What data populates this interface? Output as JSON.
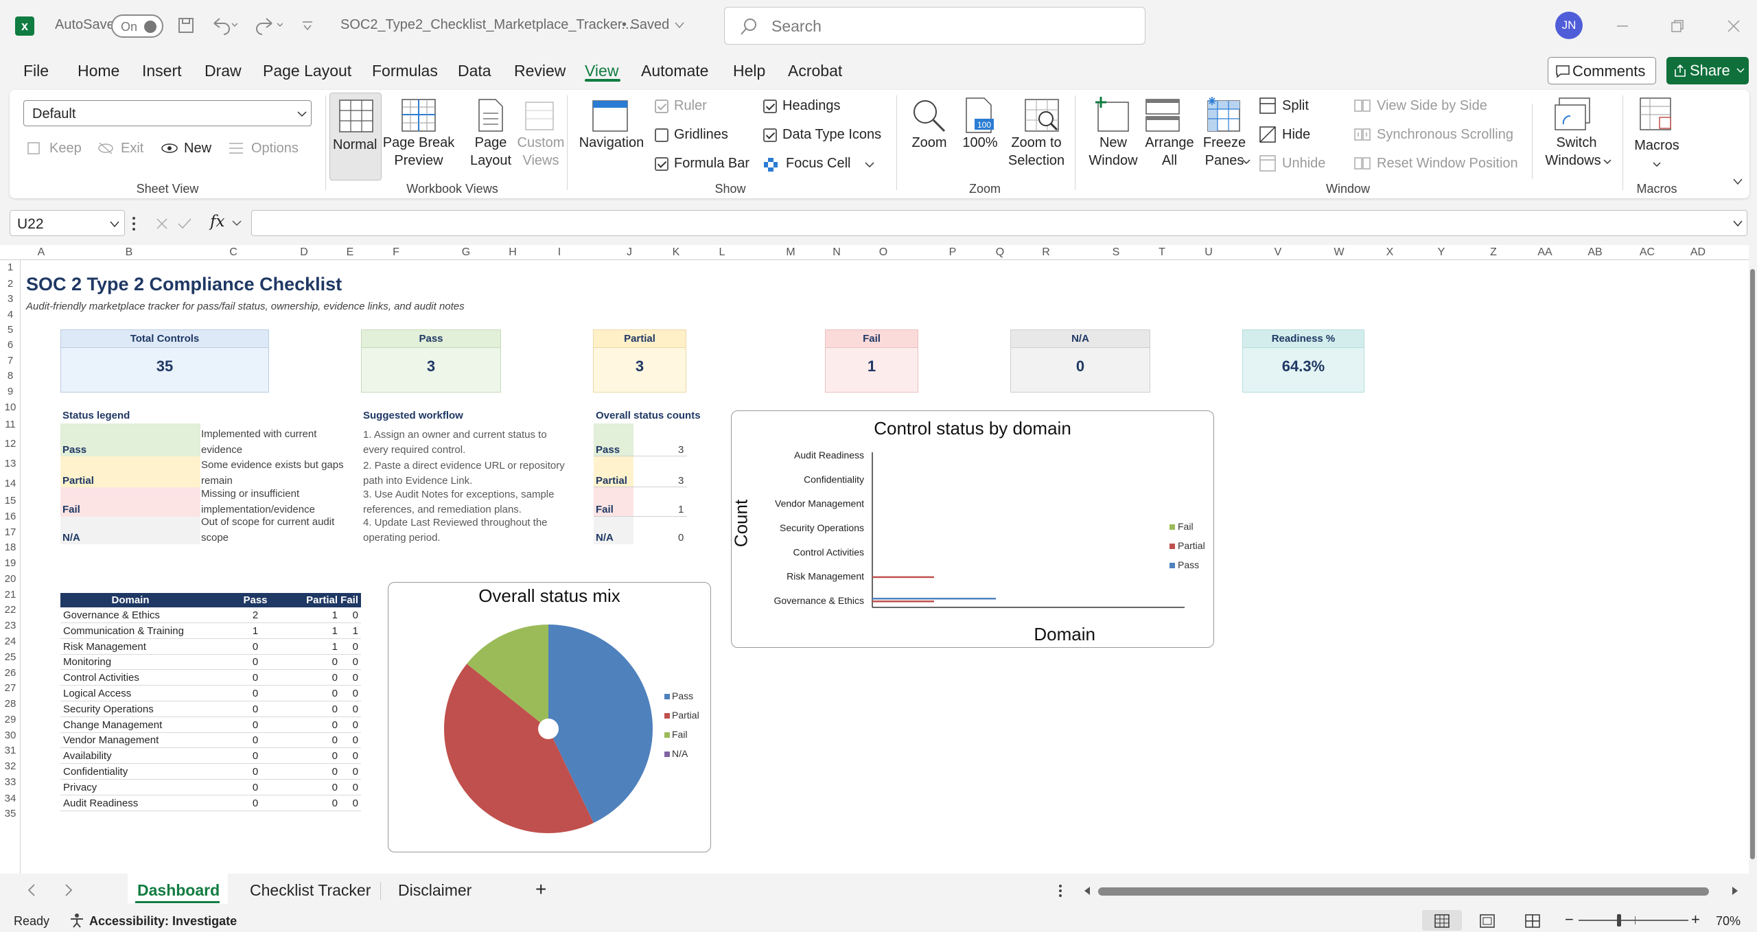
{
  "titlebar": {
    "autosave_label": "AutoSave",
    "autosave_state": "On",
    "filename": "SOC2_Type2_Checklist_Marketplace_Tracker....",
    "save_status": "• Saved",
    "search_placeholder": "Search",
    "avatar_initials": "JN"
  },
  "menu": {
    "items": [
      "File",
      "Home",
      "Insert",
      "Draw",
      "Page Layout",
      "Formulas",
      "Data",
      "Review",
      "View",
      "Automate",
      "Help",
      "Acrobat"
    ],
    "active": "View",
    "comments": "Comments",
    "share": "Share"
  },
  "ribbon": {
    "sheet_view": {
      "select_value": "Default",
      "keep": "Keep",
      "exit": "Exit",
      "new": "New",
      "options": "Options",
      "group": "Sheet View"
    },
    "workbook_views": {
      "normal": "Normal",
      "page_break_1": "Page Break",
      "page_break_2": "Preview",
      "page_layout_1": "Page",
      "page_layout_2": "Layout",
      "custom_1": "Custom",
      "custom_2": "Views",
      "group": "Workbook Views"
    },
    "show": {
      "navigation": "Navigation",
      "ruler": "Ruler",
      "gridlines": "Gridlines",
      "formula_bar": "Formula Bar",
      "headings": "Headings",
      "data_type_icons": "Data Type Icons",
      "focus_cell": "Focus Cell",
      "group": "Show"
    },
    "zoom": {
      "zoom": "Zoom",
      "hundred": "100%",
      "zoom_sel_1": "Zoom to",
      "zoom_sel_2": "Selection",
      "group": "Zoom"
    },
    "window": {
      "new_1": "New",
      "new_2": "Window",
      "arrange_1": "Arrange",
      "arrange_2": "All",
      "freeze_1": "Freeze",
      "freeze_2": "Panes",
      "split": "Split",
      "hide": "Hide",
      "unhide": "Unhide",
      "side_by_side": "View Side by Side",
      "sync": "Synchronous Scrolling",
      "reset": "Reset Window Position",
      "switch_1": "Switch",
      "switch_2": "Windows",
      "group": "Window"
    },
    "macros": {
      "macros": "Macros",
      "group": "Macros"
    }
  },
  "formula_bar": {
    "name_box": "U22",
    "fx": "fx",
    "formula": ""
  },
  "columns": [
    "A",
    "B",
    "C",
    "D",
    "E",
    "F",
    "G",
    "H",
    "I",
    "J",
    "K",
    "L",
    "M",
    "N",
    "O",
    "P",
    "Q",
    "R",
    "S",
    "T",
    "U",
    "V",
    "W",
    "X",
    "Y",
    "Z",
    "AA",
    "AB",
    "AC",
    "AD"
  ],
  "rows": [
    "1",
    "2",
    "3",
    "4",
    "5",
    "6",
    "7",
    "8",
    "9",
    "10",
    "11",
    "12",
    "13",
    "14",
    "15",
    "16",
    "17",
    "18",
    "19",
    "20",
    "21",
    "22",
    "23",
    "24",
    "25",
    "26",
    "27",
    "28",
    "29",
    "30",
    "31",
    "32",
    "33",
    "34",
    "35"
  ],
  "sheet": {
    "title": "SOC 2 Type 2 Compliance Checklist",
    "subtitle": "Audit-friendly marketplace tracker for pass/fail status, ownership, evidence links, and audit notes",
    "kpis": [
      {
        "label": "Total Controls",
        "value": "35"
      },
      {
        "label": "Pass",
        "value": "3"
      },
      {
        "label": "Partial",
        "value": "3"
      },
      {
        "label": "Fail",
        "value": "1"
      },
      {
        "label": "N/A",
        "value": "0"
      },
      {
        "label": "Readiness %",
        "value": "64.3%"
      }
    ],
    "legend_title": "Status legend",
    "legend": [
      {
        "status": "Pass",
        "desc1": "Implemented with current",
        "desc2": "evidence"
      },
      {
        "status": "Partial",
        "desc1": "Some evidence exists but gaps",
        "desc2": "remain"
      },
      {
        "status": "Fail",
        "desc1": "Missing or insufficient",
        "desc2": "implementation/evidence"
      },
      {
        "status": "N/A",
        "desc1": "Out of scope for current audit",
        "desc2": "scope"
      }
    ],
    "workflow_title": "Suggested workflow",
    "workflow": [
      "1. Assign an owner and current status to",
      "every required control.",
      "2. Paste a direct evidence URL or repository",
      "path into Evidence Link.",
      "3. Use Audit Notes for exceptions, sample",
      "references, and remediation plans.",
      "4. Update Last Reviewed throughout the",
      "operating period."
    ],
    "counts_title": "Overall status counts",
    "counts": [
      {
        "status": "Pass",
        "value": "3"
      },
      {
        "status": "Partial",
        "value": "3"
      },
      {
        "status": "Fail",
        "value": "1"
      },
      {
        "status": "N/A",
        "value": "0"
      }
    ],
    "domain_table": {
      "headers": [
        "Domain",
        "Pass",
        "Partial",
        "Fail"
      ],
      "rows": [
        [
          "Governance & Ethics",
          "2",
          "1",
          "0"
        ],
        [
          "Communication & Training",
          "1",
          "1",
          "1"
        ],
        [
          "Risk Management",
          "0",
          "1",
          "0"
        ],
        [
          "Monitoring",
          "0",
          "0",
          "0"
        ],
        [
          "Control Activities",
          "0",
          "0",
          "0"
        ],
        [
          "Logical Access",
          "0",
          "0",
          "0"
        ],
        [
          "Security Operations",
          "0",
          "0",
          "0"
        ],
        [
          "Change Management",
          "0",
          "0",
          "0"
        ],
        [
          "Vendor Management",
          "0",
          "0",
          "0"
        ],
        [
          "Availability",
          "0",
          "0",
          "0"
        ],
        [
          "Confidentiality",
          "0",
          "0",
          "0"
        ],
        [
          "Privacy",
          "0",
          "0",
          "0"
        ],
        [
          "Audit Readiness",
          "0",
          "0",
          "0"
        ]
      ]
    }
  },
  "colors": {
    "pass": "#4f81bd",
    "partial": "#c0504d",
    "fail": "#9bbb59",
    "na": "#8064a2",
    "accent": "#107c41"
  },
  "chart_data": [
    {
      "type": "pie",
      "title": "Overall status mix",
      "categories": [
        "Pass",
        "Partial",
        "Fail",
        "N/A"
      ],
      "values": [
        3,
        3,
        1,
        0
      ],
      "legend": "right"
    },
    {
      "type": "bar",
      "orientation": "horizontal",
      "title": "Control status by domain",
      "xlabel": "Domain",
      "ylabel": "Count",
      "categories": [
        "Governance & Ethics",
        "Risk Management",
        "Control Activities",
        "Security Operations",
        "Vendor Management",
        "Confidentiality",
        "Audit Readiness"
      ],
      "series": [
        {
          "name": "Pass",
          "values": [
            2,
            0,
            0,
            0,
            0,
            0,
            0
          ]
        },
        {
          "name": "Partial",
          "values": [
            1,
            1,
            0,
            0,
            0,
            0,
            0
          ]
        },
        {
          "name": "Fail",
          "values": [
            0,
            0,
            0,
            0,
            0,
            0,
            0
          ]
        }
      ],
      "legend": "right"
    }
  ],
  "tabs": {
    "items": [
      "Dashboard",
      "Checklist Tracker",
      "Disclaimer"
    ],
    "active": "Dashboard",
    "add": "+"
  },
  "status": {
    "ready": "Ready",
    "accessibility": "Accessibility: Investigate",
    "zoom": "70%",
    "zoom_minus": "−",
    "zoom_plus": "+"
  }
}
